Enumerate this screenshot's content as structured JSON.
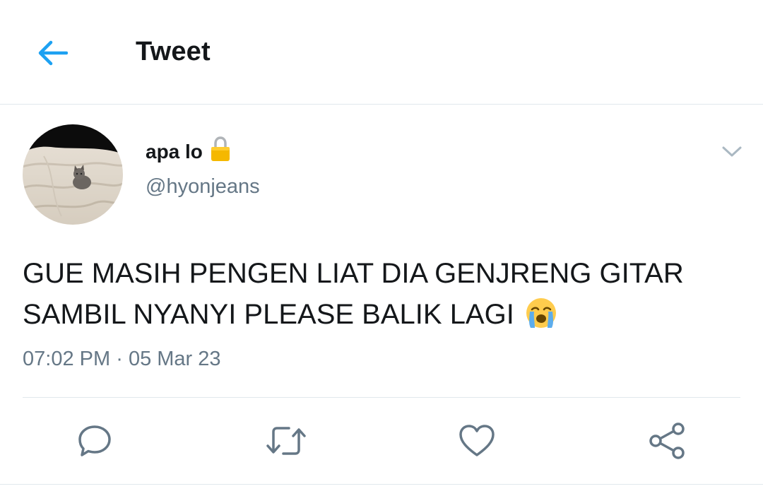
{
  "header": {
    "title": "Tweet",
    "back_icon": "arrow-left-icon"
  },
  "tweet": {
    "user": {
      "display_name": "apa lo",
      "handle": "@hyonjeans",
      "lock_icon": "lock-icon",
      "avatar": "cat-on-bed-avatar"
    },
    "text_line1": "GUE MASIH PENGEN LIAT DIA GENJRENG GITAR",
    "text_line2": "SAMBIL NYANYI PLEASE BALIK LAGI",
    "emoji": "loudly-crying-face-emoji",
    "time": "07:02 PM",
    "separator": "·",
    "date": "05 Mar 23"
  },
  "actions": [
    {
      "name": "reply",
      "icon": "comment-icon"
    },
    {
      "name": "retweet",
      "icon": "retweet-icon"
    },
    {
      "name": "like",
      "icon": "heart-icon"
    },
    {
      "name": "share",
      "icon": "share-icon"
    }
  ],
  "colors": {
    "accent": "#1da1f2",
    "text": "#14171a",
    "secondary": "#657786",
    "border": "#e1e8ed"
  }
}
